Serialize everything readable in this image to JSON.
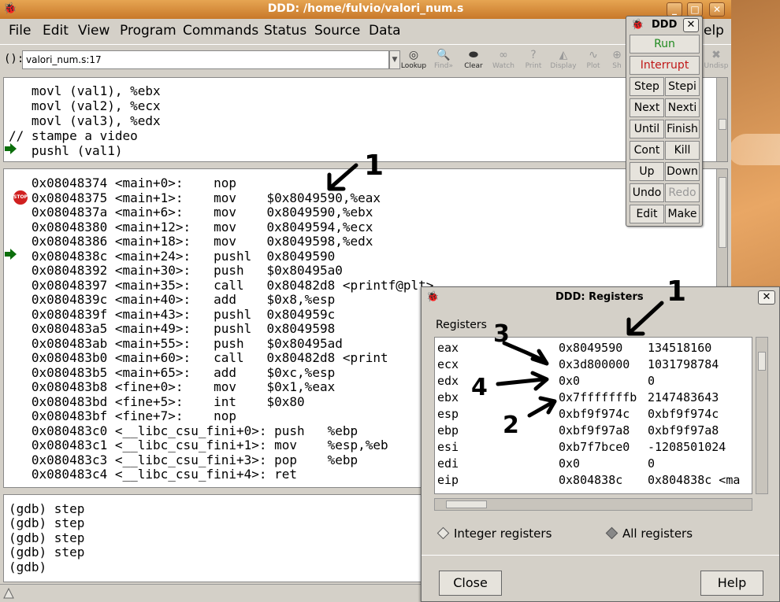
{
  "window": {
    "title": "DDD: /home/fulvio/valori_num.s"
  },
  "menu": [
    "File",
    "Edit",
    "View",
    "Program",
    "Commands",
    "Status",
    "Source",
    "Data"
  ],
  "menu_help_fragment": "elp",
  "argbar": {
    "label": "():",
    "value": "valori_num.s:17"
  },
  "toolbar": [
    {
      "label": "Lookup",
      "icon": "lookup-icon",
      "enabled": true
    },
    {
      "label": "Find»",
      "icon": "find-icon",
      "enabled": false
    },
    {
      "label": "Clear",
      "icon": "clear-icon",
      "enabled": true
    },
    {
      "label": "Watch",
      "icon": "watch-icon",
      "enabled": false
    },
    {
      "label": "Print",
      "icon": "print-icon",
      "enabled": false
    },
    {
      "label": "Display",
      "icon": "display-icon",
      "enabled": false
    },
    {
      "label": "Plot",
      "icon": "plot-icon",
      "enabled": false
    },
    {
      "label": "Sh",
      "icon": "show-icon",
      "enabled": false
    },
    {
      "label": "Undisp",
      "icon": "undisplay-icon",
      "enabled": false
    }
  ],
  "source_lines": [
    "   movl (val1), %ebx",
    "   movl (val2), %ecx",
    "   movl (val3), %edx",
    "// stampe a video",
    "   pushl (val1)"
  ],
  "asm_lines": [
    "   0x08048374 <main+0>:    nop",
    "   0x08048375 <main+1>:    mov    $0x8049590,%eax",
    "   0x0804837a <main+6>:    mov    0x8049590,%ebx",
    "   0x08048380 <main+12>:   mov    0x8049594,%ecx",
    "   0x08048386 <main+18>:   mov    0x8049598,%edx",
    "   0x0804838c <main+24>:   pushl  0x8049590",
    "   0x08048392 <main+30>:   push   $0x80495a0",
    "   0x08048397 <main+35>:   call   0x80482d8 <printf@plt>",
    "   0x0804839c <main+40>:   add    $0x8,%esp",
    "   0x0804839f <main+43>:   pushl  0x804959c",
    "   0x080483a5 <main+49>:   pushl  0x8049598",
    "   0x080483ab <main+55>:   push   $0x80495ad",
    "   0x080483b0 <main+60>:   call   0x80482d8 <print",
    "   0x080483b5 <main+65>:   add    $0xc,%esp",
    "   0x080483b8 <fine+0>:    mov    $0x1,%eax",
    "   0x080483bd <fine+5>:    int    $0x80",
    "   0x080483bf <fine+7>:    nop",
    "   0x080483c0 <__libc_csu_fini+0>: push   %ebp",
    "   0x080483c1 <__libc_csu_fini+1>: mov    %esp,%eb",
    "   0x080483c3 <__libc_csu_fini+3>: pop    %ebp",
    "   0x080483c4 <__libc_csu_fini+4>: ret"
  ],
  "gdb_lines": [
    "(gdb) step",
    "(gdb) step",
    "(gdb) step",
    "(gdb) step",
    "(gdb)"
  ],
  "stop_label": "STOP",
  "command_tool": {
    "title": "DDD",
    "close": "✕",
    "run": "Run",
    "interrupt": "Interrupt",
    "pairs": [
      [
        "Step",
        "Stepi"
      ],
      [
        "Next",
        "Nexti"
      ],
      [
        "Until",
        "Finish"
      ],
      [
        "Cont",
        "Kill"
      ],
      [
        "Up",
        "Down"
      ],
      [
        "Undo",
        "Redo"
      ],
      [
        "Edit",
        "Make"
      ]
    ]
  },
  "registers_dialog": {
    "title": "DDD: Registers",
    "close": "✕",
    "label": "Registers",
    "rows": [
      {
        "name": "eax",
        "hex": "0x8049590",
        "dec": "134518160"
      },
      {
        "name": "ecx",
        "hex": "0x3d800000",
        "dec": "1031798784"
      },
      {
        "name": "edx",
        "hex": "0x0",
        "dec": "0"
      },
      {
        "name": "ebx",
        "hex": "0x7fffffffb",
        "dec": "2147483643"
      },
      {
        "name": "esp",
        "hex": "0xbf9f974c",
        "dec": "0xbf9f974c"
      },
      {
        "name": "ebp",
        "hex": "0xbf9f97a8",
        "dec": "0xbf9f97a8"
      },
      {
        "name": "esi",
        "hex": "0xb7f7bce0",
        "dec": "-1208501024"
      },
      {
        "name": "edi",
        "hex": "0x0",
        "dec": "0"
      },
      {
        "name": "eip",
        "hex": "0x804838c",
        "dec": "0x804838c <ma"
      }
    ],
    "radio_integer": "Integer registers",
    "radio_all": "All registers",
    "close_button": "Close",
    "help_button": "Help"
  },
  "annotations": {
    "num1": "1",
    "num2": "2",
    "num3": "3",
    "num4": "4"
  },
  "colors": {
    "title_orange": "#d8893a",
    "run_green": "#1f8a1f",
    "interrupt_red": "#c01818",
    "exec_arrow": "#0b6e0b",
    "annotation_ink": "#000000"
  }
}
